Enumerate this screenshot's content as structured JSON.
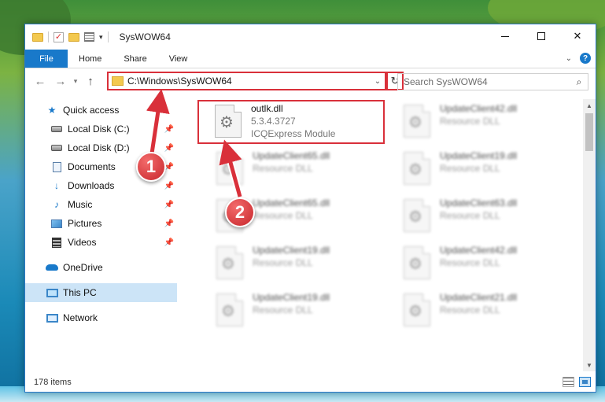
{
  "window": {
    "title": "SysWOW64",
    "controls": {
      "minimize_icon": "minimize-icon",
      "maximize_icon": "maximize-icon",
      "close_symbol": "✕"
    }
  },
  "ribbon": {
    "tabs": [
      {
        "label": "File"
      },
      {
        "label": "Home"
      },
      {
        "label": "Share"
      },
      {
        "label": "View"
      }
    ],
    "help_symbol": "?"
  },
  "navigation": {
    "back_symbol": "←",
    "forward_symbol": "→",
    "up_symbol": "↑",
    "address_path": "C:\\Windows\\SysWOW64",
    "refresh_symbol": "↻",
    "search_placeholder": "Search SysWOW64",
    "search_symbol": "⌕"
  },
  "nav_pane": {
    "items": [
      {
        "label": "Quick access",
        "icon": "star-icon",
        "pinned": false
      },
      {
        "label": "Local Disk (C:)",
        "icon": "drive-icon",
        "pinned": true
      },
      {
        "label": "Local Disk (D:)",
        "icon": "drive-icon",
        "pinned": true
      },
      {
        "label": "Documents",
        "icon": "documents-icon",
        "pinned": true
      },
      {
        "label": "Downloads",
        "icon": "downloads-icon",
        "pinned": true
      },
      {
        "label": "Music",
        "icon": "music-icon",
        "pinned": true
      },
      {
        "label": "Pictures",
        "icon": "pictures-icon",
        "pinned": true
      },
      {
        "label": "Videos",
        "icon": "videos-icon",
        "pinned": true
      },
      {
        "label": "OneDrive",
        "icon": "onedrive-icon",
        "pinned": false
      },
      {
        "label": "This PC",
        "icon": "this-pc-icon",
        "pinned": false,
        "selected": true
      },
      {
        "label": "Network",
        "icon": "network-icon",
        "pinned": false
      }
    ]
  },
  "files": [
    {
      "name": "outlk.dll",
      "line1": "5.3.4.3727",
      "line2": "ICQExpress Module",
      "highlighted": true
    },
    {
      "name": "UpdateClient42.dll",
      "line1": "Resource DLL",
      "line2": ""
    },
    {
      "name": "UpdateClient65.dll",
      "line1": "Resource DLL",
      "line2": ""
    },
    {
      "name": "UpdateClient19.dll",
      "line1": "Resource DLL",
      "line2": ""
    },
    {
      "name": "UpdateClient65.dll",
      "line1": "Resource DLL",
      "line2": ""
    },
    {
      "name": "UpdateClient63.dll",
      "line1": "Resource DLL",
      "line2": ""
    },
    {
      "name": "UpdateClient19.dll",
      "line1": "Resource DLL",
      "line2": ""
    },
    {
      "name": "UpdateClient42.dll",
      "line1": "Resource DLL",
      "line2": ""
    },
    {
      "name": "UpdateClient19.dll",
      "line1": "Resource DLL",
      "line2": ""
    },
    {
      "name": "UpdateClient21.dll",
      "line1": "Resource DLL",
      "line2": ""
    }
  ],
  "status_bar": {
    "item_count": "178 items"
  },
  "annotations": [
    {
      "number": "1"
    },
    {
      "number": "2"
    }
  ],
  "colors": {
    "accent": "#1979ca",
    "highlight_border": "#d9303a",
    "selected_nav": "#cce4f7"
  }
}
